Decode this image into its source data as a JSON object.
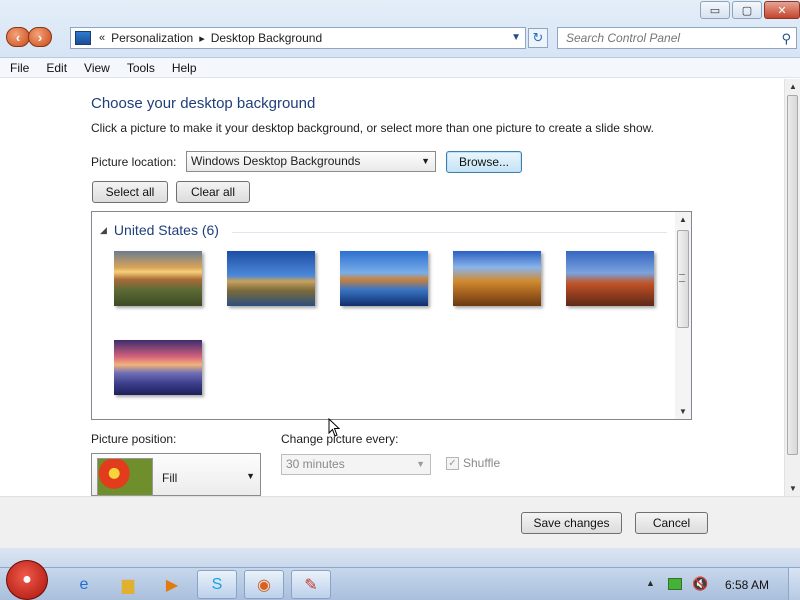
{
  "window": {
    "caption_buttons": {
      "minimize": "▭",
      "maximize": "▢",
      "close": "✕"
    }
  },
  "nav": {
    "back_icon": "back-arrow-icon",
    "forward_icon": "forward-arrow-icon"
  },
  "address": {
    "prefix": "«",
    "crumbs": [
      "Personalization",
      "Desktop Background"
    ],
    "separator": "▸"
  },
  "search": {
    "placeholder": "Search Control Panel"
  },
  "menu": [
    "File",
    "Edit",
    "View",
    "Tools",
    "Help"
  ],
  "main": {
    "heading": "Choose your desktop background",
    "description": "Click a picture to make it your desktop background, or select more than one picture to create a slide show.",
    "picture_location_label": "Picture location:",
    "picture_location_value": "Windows Desktop Backgrounds",
    "browse_label": "Browse...",
    "select_all_label": "Select all",
    "clear_all_label": "Clear all",
    "group_label": "United States (6)",
    "thumbnails": [
      "sunset-prairie",
      "lighthouse-coast",
      "rock-reflection",
      "hay-bale",
      "delicate-arch",
      "lupine-lake"
    ],
    "picture_position_label": "Picture position:",
    "picture_position_value": "Fill",
    "change_every_label": "Change picture every:",
    "change_every_value": "30 minutes",
    "shuffle_label": "Shuffle",
    "shuffle_checked": true
  },
  "footer": {
    "save_label": "Save changes",
    "cancel_label": "Cancel"
  },
  "taskbar": {
    "clock": "6:58 AM"
  },
  "colors": {
    "accent": "#1f3f7a",
    "taskbar": "#b8cbe4"
  }
}
